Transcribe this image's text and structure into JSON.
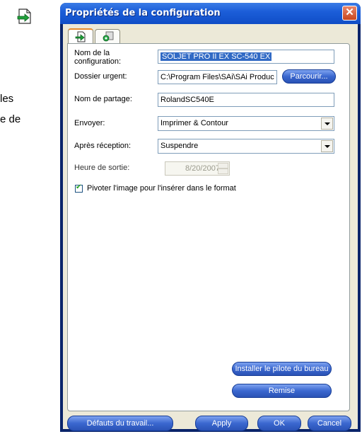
{
  "background": {
    "text_line1": "les",
    "text_line2": "e de",
    "icon": "export-document-icon"
  },
  "dialog": {
    "title": "Propriétés de la configuration",
    "close_glyph": "✕",
    "tabs": [
      {
        "icon": "export-arrow-icon",
        "active": true
      },
      {
        "icon": "settings-gear-icon",
        "active": false
      }
    ],
    "fields": {
      "config_name_label": "Nom de la configuration:",
      "config_name_value": "SOLJET PRO II EX SC-540 EX",
      "urgent_folder_label": "Dossier urgent:",
      "urgent_folder_value": "C:\\Program Files\\SAi\\SAi Produc",
      "browse_button": "Parcourir...",
      "share_name_label": "Nom de partage:",
      "share_name_value": "RolandSC540E",
      "send_label": "Envoyer:",
      "send_value": "Imprimer & Contour",
      "after_receive_label": "Après réception:",
      "after_receive_value": "Suspendre",
      "output_time_label": "Heure de sortie:",
      "output_time_value": "8/20/2007",
      "rotate_checkbox_label": "Pivoter l'image pour l'insérer dans le format",
      "rotate_checked": true
    },
    "panel_buttons": {
      "install_driver": "Installer le pilote du bureau",
      "reset": "Remise"
    },
    "footer_buttons": {
      "job_defaults": "Défauts du travail...",
      "apply": "Apply",
      "ok": "OK",
      "cancel": "Cancel"
    }
  }
}
